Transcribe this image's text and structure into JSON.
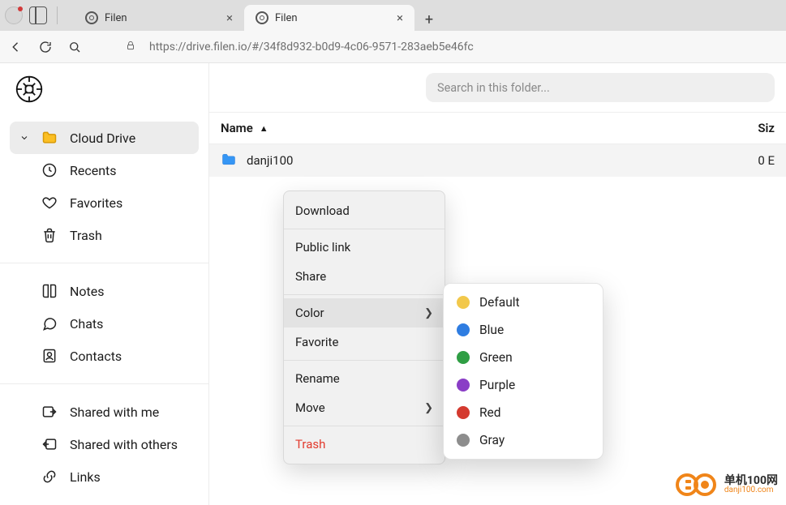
{
  "browser": {
    "tabs": [
      {
        "title": "Filen",
        "active": false
      },
      {
        "title": "Filen",
        "active": true
      }
    ],
    "url_host": "drive.filen.io",
    "url_path_display": "https://drive.filen.io/#/34f8d932-b0d9-4c06-9571-283aeb5e46fc"
  },
  "search": {
    "placeholder": "Search in this folder..."
  },
  "sidebar": {
    "groups": [
      {
        "items": [
          {
            "label": "Cloud Drive",
            "icon": "folder-icon",
            "selected": true,
            "expand": true
          },
          {
            "label": "Recents",
            "icon": "clock-icon"
          },
          {
            "label": "Favorites",
            "icon": "heart-icon"
          },
          {
            "label": "Trash",
            "icon": "trash-icon"
          }
        ]
      },
      {
        "items": [
          {
            "label": "Notes",
            "icon": "book-icon"
          },
          {
            "label": "Chats",
            "icon": "chat-icon"
          },
          {
            "label": "Contacts",
            "icon": "contacts-icon"
          }
        ]
      },
      {
        "items": [
          {
            "label": "Shared with me",
            "icon": "shared-in-icon"
          },
          {
            "label": "Shared with others",
            "icon": "shared-out-icon"
          },
          {
            "label": "Links",
            "icon": "link-icon"
          }
        ]
      }
    ]
  },
  "table": {
    "columns": {
      "name": "Name",
      "size": "Siz"
    },
    "rows": [
      {
        "name": "danji100",
        "size": "0 E"
      }
    ]
  },
  "context_menu": {
    "items": [
      {
        "label": "Download"
      },
      {
        "sep": true
      },
      {
        "label": "Public link"
      },
      {
        "label": "Share"
      },
      {
        "sep": true
      },
      {
        "label": "Color",
        "submenu": true,
        "hover": true
      },
      {
        "label": "Favorite"
      },
      {
        "sep": true
      },
      {
        "label": "Rename"
      },
      {
        "label": "Move",
        "submenu": true
      },
      {
        "sep": true
      },
      {
        "label": "Trash",
        "danger": true
      }
    ],
    "color_submenu": [
      {
        "label": "Default",
        "color": "#f2c84b"
      },
      {
        "label": "Blue",
        "color": "#2f7de1"
      },
      {
        "label": "Green",
        "color": "#2f9e44"
      },
      {
        "label": "Purple",
        "color": "#8a3ec6"
      },
      {
        "label": "Red",
        "color": "#d43a2f"
      },
      {
        "label": "Gray",
        "color": "#8d8d8d"
      }
    ]
  },
  "watermark": {
    "line1": "单机100网",
    "line2": "danji100.com"
  }
}
